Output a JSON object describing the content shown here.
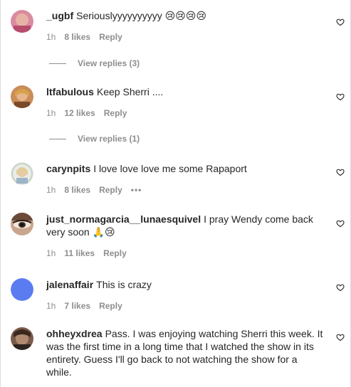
{
  "comments": [
    {
      "username": "_ugbf",
      "text": "Seriouslyyyyyyyyyy 😢😢😢😢",
      "time": "1h",
      "likes": "8 likes",
      "reply": "Reply",
      "view_replies": "View replies (3)"
    },
    {
      "username": "ltfabulous",
      "text": "Keep Sherri ....",
      "time": "1h",
      "likes": "12 likes",
      "reply": "Reply",
      "view_replies": "View replies (1)"
    },
    {
      "username": "carynpits",
      "text": "I love love love me some Rapaport",
      "time": "1h",
      "likes": "8 likes",
      "reply": "Reply",
      "more": "•••"
    },
    {
      "username": "just_normagarcia__lunaesquivel",
      "text": "I pray Wendy come back very soon 🙏😢",
      "time": "1h",
      "likes": "11 likes",
      "reply": "Reply"
    },
    {
      "username": "jalenaffair",
      "text": "This is crazy",
      "time": "1h",
      "likes": "7 likes",
      "reply": "Reply"
    },
    {
      "username": "ohheyxdrea",
      "text": "Pass. I was enjoying watching Sherri this week. It was the first time in a long time that I watched the show in its entirety. Guess I'll go back to not watching the show for a while."
    }
  ],
  "colors": {
    "text": "#262626",
    "secondary": "#8e8e8e",
    "avatar_blue": "#5b7bf0"
  },
  "icons": {
    "like": "heart-outline-icon"
  }
}
